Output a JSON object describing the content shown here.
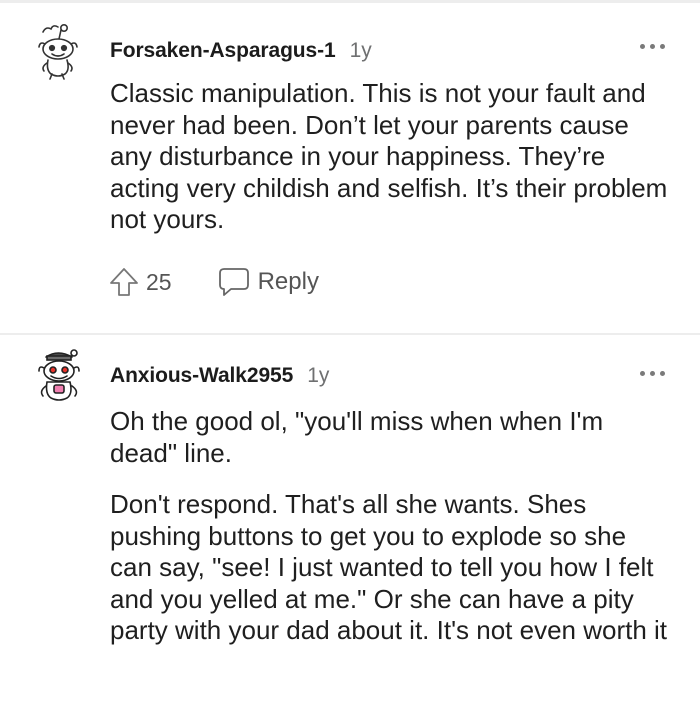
{
  "comments": [
    {
      "username": "Forsaken-Asparagus-1",
      "age": "1y",
      "avatar_icon": "snoo-sketch-avatar-icon",
      "paragraphs": [
        "Classic manipulation. This is not your fault and never had been. Don’t let your parents cause any disturbance in your happiness. They’re acting very childish and selfish. It’s their problem not yours."
      ],
      "score": "25",
      "reply_label": "Reply"
    },
    {
      "username": "Anxious-Walk2955",
      "age": "1y",
      "avatar_icon": "snoo-cap-avatar-icon",
      "paragraphs": [
        "Oh the good ol, \"you'll miss when when I'm dead\" line.",
        "Don't respond. That's all she wants. Shes pushing buttons to get you to explode so she can say, \"see! I just wanted to tell you how I felt and you yelled at me.\" Or she can have a pity party with your dad about it. It's not even worth it"
      ]
    }
  ],
  "colors": {
    "text": "#1f1f1f",
    "muted": "#6f7071",
    "divider": "#ededed",
    "avatar_accent": "#e8322a"
  }
}
